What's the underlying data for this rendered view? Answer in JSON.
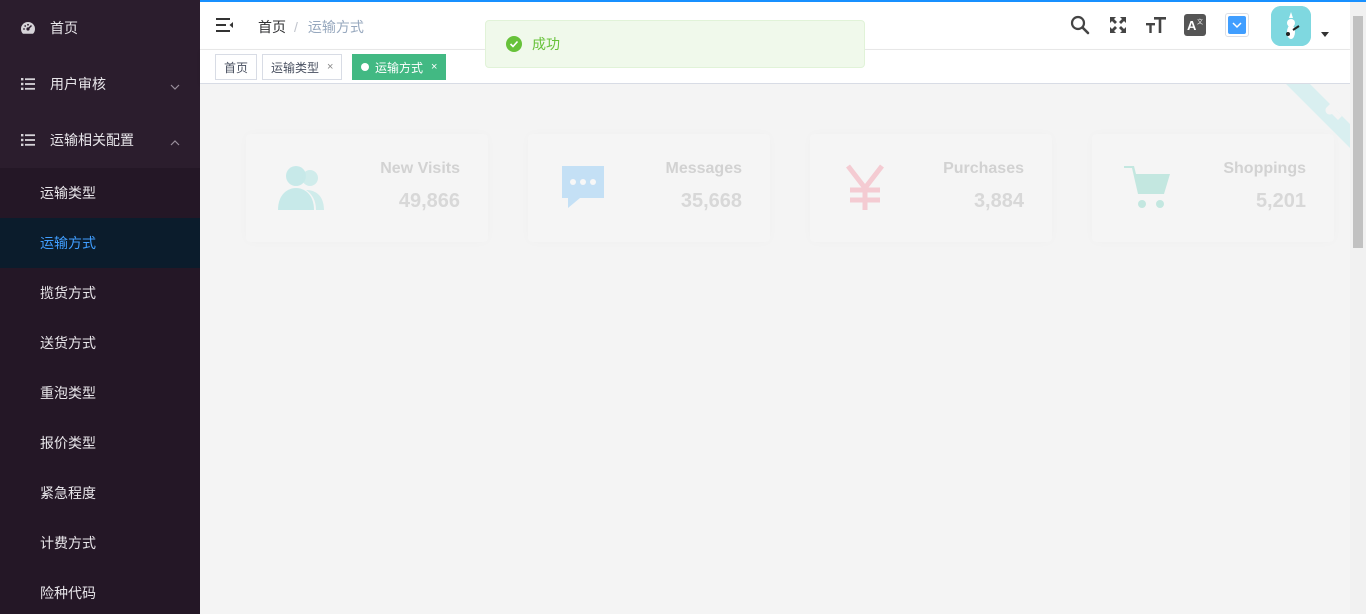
{
  "sidebar": {
    "items": [
      {
        "label": "首页",
        "icon": "dashboard-icon"
      },
      {
        "label": "用户审核",
        "icon": "list-icon",
        "expanded": false
      },
      {
        "label": "运输相关配置",
        "icon": "list-icon",
        "expanded": true
      }
    ],
    "submenu": [
      {
        "label": "运输类型",
        "active": false
      },
      {
        "label": "运输方式",
        "active": true
      },
      {
        "label": "揽货方式",
        "active": false
      },
      {
        "label": "送货方式",
        "active": false
      },
      {
        "label": "重泡类型",
        "active": false
      },
      {
        "label": "报价类型",
        "active": false
      },
      {
        "label": "紧急程度",
        "active": false
      },
      {
        "label": "计费方式",
        "active": false
      },
      {
        "label": "险种代码",
        "active": false
      }
    ]
  },
  "header": {
    "breadcrumb": {
      "home": "首页",
      "separator": "/",
      "current": "运输方式"
    },
    "icons": [
      "search-icon",
      "fullscreen-icon",
      "font-size-icon",
      "translate-icon",
      "size-select-icon"
    ]
  },
  "tags": [
    {
      "label": "首页",
      "active": false,
      "closable": false
    },
    {
      "label": "运输类型",
      "active": false,
      "closable": true,
      "close": "×"
    },
    {
      "label": "运输方式",
      "active": true,
      "closable": true,
      "close": "×"
    }
  ],
  "dashboard": {
    "cards": [
      {
        "label": "New Visits",
        "value": "49,866",
        "icon": "people-icon",
        "color": "#40c9c6"
      },
      {
        "label": "Messages",
        "value": "35,668",
        "icon": "message-icon",
        "color": "#36a3f7"
      },
      {
        "label": "Purchases",
        "value": "3,884",
        "icon": "money-icon",
        "color": "#f4516c"
      },
      {
        "label": "Shoppings",
        "value": "5,201",
        "icon": "shopping-cart-icon",
        "color": "#34bfa3"
      }
    ]
  },
  "toast": {
    "text": "成功",
    "type": "success",
    "color": "#67c23a"
  },
  "colors": {
    "sidebar_bg": "#2b1d2d",
    "active_menu_text": "#409eff",
    "active_tag": "#42b983"
  }
}
